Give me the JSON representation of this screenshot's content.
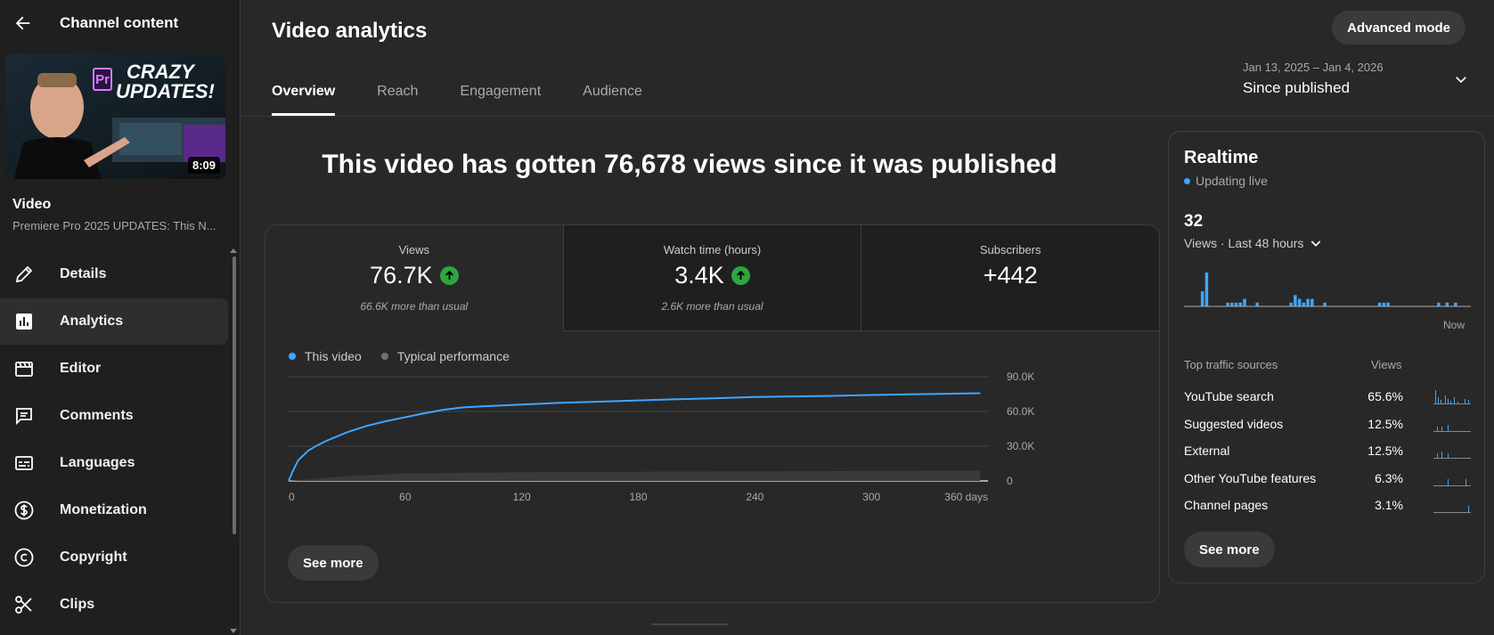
{
  "sidebar": {
    "back_label": "Channel content",
    "video_label": "Video",
    "video_title": "Premiere Pro 2025 UPDATES: This N...",
    "thumbnail": {
      "text_line1": "CRAZY",
      "text_line2": "UPDATES!",
      "badge": "Pr",
      "duration": "8:09"
    },
    "items": [
      {
        "label": "Details",
        "icon": "pencil-icon"
      },
      {
        "label": "Analytics",
        "icon": "analytics-icon",
        "active": true
      },
      {
        "label": "Editor",
        "icon": "clapperboard-icon"
      },
      {
        "label": "Comments",
        "icon": "comment-icon"
      },
      {
        "label": "Languages",
        "icon": "subtitles-icon"
      },
      {
        "label": "Monetization",
        "icon": "dollar-icon"
      },
      {
        "label": "Copyright",
        "icon": "copyright-icon"
      },
      {
        "label": "Clips",
        "icon": "scissors-icon"
      }
    ]
  },
  "header": {
    "title": "Video analytics",
    "advanced_mode": "Advanced mode",
    "tabs": [
      "Overview",
      "Reach",
      "Engagement",
      "Audience"
    ],
    "date_range": "Jan 13, 2025 – Jan 4, 2026",
    "date_label": "Since published"
  },
  "headline": "This video has gotten 76,678 views since it was published",
  "metrics": [
    {
      "label": "Views",
      "value": "76.7K",
      "note": "66.6K more than usual",
      "trend": "up"
    },
    {
      "label": "Watch time (hours)",
      "value": "3.4K",
      "note": "2.6K more than usual",
      "trend": "up"
    },
    {
      "label": "Subscribers",
      "value": "+442",
      "note": ""
    }
  ],
  "legend": {
    "series1": "This video",
    "series2": "Typical performance"
  },
  "see_more": "See more",
  "chart_data": {
    "type": "line",
    "x_ticks": [
      "0",
      "60",
      "120",
      "180",
      "240",
      "300",
      "360 days"
    ],
    "y_ticks": [
      "90.0K",
      "60.0K",
      "30.0K",
      "0"
    ],
    "ylim": [
      0,
      90000
    ],
    "xlim": [
      0,
      360
    ],
    "series": [
      {
        "name": "This video",
        "color": "#3ea6ff",
        "x": [
          0,
          2,
          5,
          10,
          15,
          20,
          30,
          40,
          50,
          60,
          70,
          80,
          90,
          100,
          120,
          140,
          160,
          180,
          200,
          220,
          240,
          260,
          280,
          300,
          320,
          340,
          356
        ],
        "y": [
          0,
          8000,
          18000,
          26000,
          31000,
          35000,
          42000,
          47500,
          51500,
          55000,
          58500,
          61500,
          63500,
          64500,
          66000,
          67500,
          68500,
          69500,
          70500,
          71500,
          72500,
          73000,
          73500,
          74200,
          74800,
          75300,
          75800
        ]
      },
      {
        "name": "Typical performance",
        "color": "#555555",
        "x": [
          0,
          30,
          60,
          120,
          180,
          240,
          300,
          356
        ],
        "y": [
          0,
          4000,
          6500,
          7500,
          8000,
          8300,
          8600,
          8800
        ]
      }
    ]
  },
  "realtime": {
    "title": "Realtime",
    "live": "Updating live",
    "count": "32",
    "views_label": "Views · Last 48 hours",
    "now": "Now",
    "spark": [
      0,
      0,
      0,
      0,
      4,
      9,
      0,
      0,
      0,
      0,
      1,
      1,
      1,
      1,
      2,
      0,
      0,
      1,
      0,
      0,
      0,
      0,
      0,
      0,
      0,
      1,
      3,
      2,
      1,
      2,
      2,
      0,
      0,
      1,
      0,
      0,
      0,
      0,
      0,
      0,
      0,
      0,
      0,
      0,
      0,
      0,
      1,
      1,
      1,
      0,
      0,
      0,
      0,
      0,
      0,
      0,
      0,
      0,
      0,
      0,
      1,
      0,
      1,
      0,
      1,
      0,
      0,
      0
    ],
    "traffic_header": "Top traffic sources",
    "traffic_views_header": "Views",
    "sources": [
      {
        "name": "YouTube search",
        "pct": "65.6%"
      },
      {
        "name": "Suggested videos",
        "pct": "12.5%"
      },
      {
        "name": "External",
        "pct": "12.5%"
      },
      {
        "name": "Other YouTube features",
        "pct": "6.3%"
      },
      {
        "name": "Channel pages",
        "pct": "3.1%"
      }
    ],
    "see_more": "See more"
  }
}
